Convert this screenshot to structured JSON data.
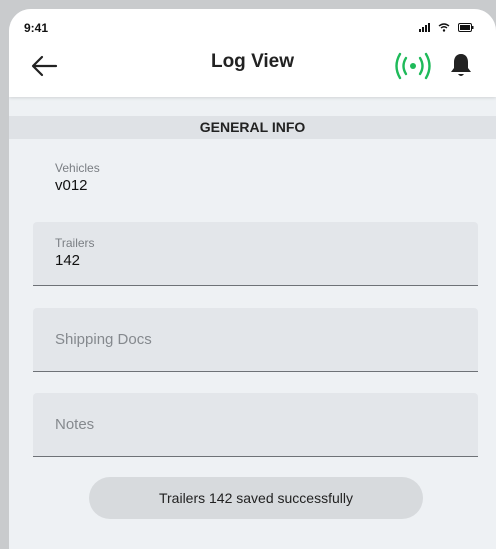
{
  "status_bar": {
    "time": "9:41"
  },
  "header": {
    "title": "Log View",
    "back_icon": "arrow-left-icon",
    "broadcast_icon": "broadcast-icon",
    "bell_icon": "bell-icon",
    "broadcast_color": "#1fba5a"
  },
  "section": {
    "title": "GENERAL INFO"
  },
  "fields": {
    "vehicles": {
      "label": "Vehicles",
      "value": "v012"
    },
    "trailers": {
      "label": "Trailers",
      "value": "142"
    },
    "shipping_docs": {
      "placeholder": "Shipping Docs"
    },
    "notes": {
      "placeholder": "Notes"
    }
  },
  "toast": {
    "message": "Trailers 142 saved successfully"
  }
}
